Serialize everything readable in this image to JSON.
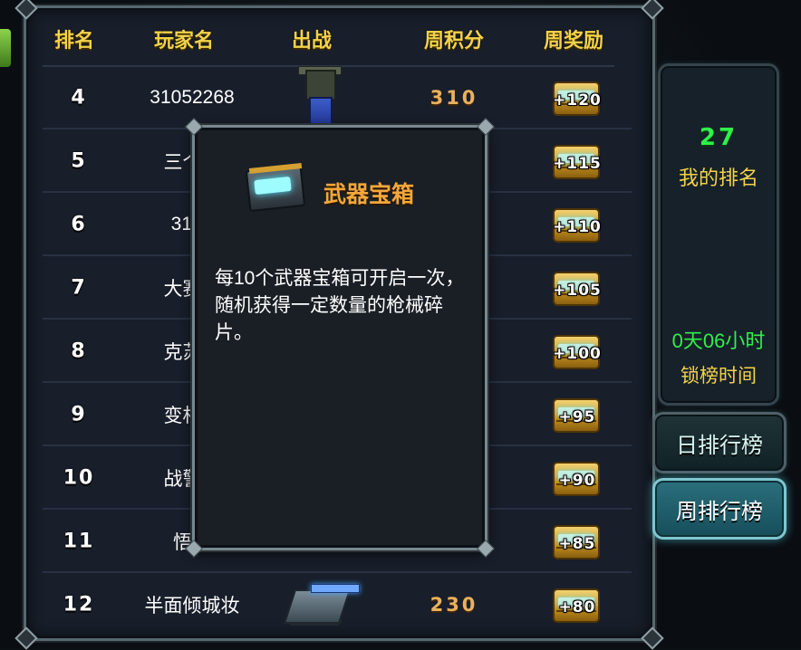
{
  "header": {
    "rank": "排名",
    "player": "玩家名",
    "battle": "出战",
    "weekly_score": "周积分",
    "weekly_reward": "周奖励"
  },
  "rows": [
    {
      "rank": "4",
      "name": "31052268",
      "score": "310",
      "reward": "+120",
      "unit": "mech"
    },
    {
      "rank": "5",
      "name": "三个尖",
      "score": "",
      "reward": "+115",
      "unit": ""
    },
    {
      "rank": "6",
      "name": "3105",
      "score": "",
      "reward": "+110",
      "unit": ""
    },
    {
      "rank": "7",
      "name": "大赛佛",
      "score": "",
      "reward": "+105",
      "unit": ""
    },
    {
      "rank": "8",
      "name": "克苏鲁",
      "score": "",
      "reward": "+100",
      "unit": ""
    },
    {
      "rank": "9",
      "name": "变相怪",
      "score": "",
      "reward": "+95",
      "unit": ""
    },
    {
      "rank": "10",
      "name": "战警机",
      "score": "",
      "reward": "+90",
      "unit": ""
    },
    {
      "rank": "11",
      "name": "悟空",
      "score": "",
      "reward": "+85",
      "unit": ""
    },
    {
      "rank": "12",
      "name": "半面倾城妆",
      "score": "230",
      "reward": "+80",
      "unit": "tank"
    }
  ],
  "side": {
    "my_rank": "27",
    "my_rank_label": "我的排名",
    "lock_time": "0天06小时",
    "lock_time_label": "锁榜时间"
  },
  "tabs": {
    "daily": "日排行榜",
    "weekly": "周排行榜",
    "active": "weekly"
  },
  "popup": {
    "title": "武器宝箱",
    "description": "每10个武器宝箱可开启一次，随机获得一定数量的枪械碎片。"
  },
  "colors": {
    "header_gold": "#f2d24a",
    "score_orange": "#e8b160",
    "rank_green": "#2ff04a",
    "popup_title": "#f2a73a"
  },
  "icons": {
    "reward": "treasure-chest-icon",
    "popup": "weapon-chest-icon"
  }
}
